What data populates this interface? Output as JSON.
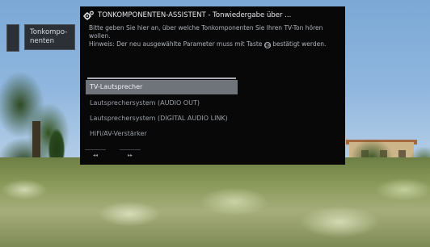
{
  "side_menu": {
    "item_label": "Tonkompo-\nnenten"
  },
  "dialog": {
    "title": "TONKOMPONENTEN-ASSISTENT - Tonwiedergabe über ...",
    "icon": "gears-icon",
    "instruction": "Bitte geben Sie hier an, über welche Tonkomponenten Sie Ihren TV-Ton hören wollen.",
    "hint_prefix": "Hinweis: Der neu ausgewählte Parameter muss mit Taste",
    "hint_symbol": "OK",
    "hint_suffix": "bestätigt werden.",
    "options": [
      {
        "label": "TV-Lautsprecher",
        "selected": true
      },
      {
        "label": "Lautsprechersystem (AUDIO OUT)",
        "selected": false
      },
      {
        "label": "Lautsprechersystem (DIGITAL AUDIO LINK)",
        "selected": false
      },
      {
        "label": "HiFi/AV-Verstärker",
        "selected": false
      }
    ],
    "nav": {
      "prev_label": "◂◂",
      "next_label": "▸▸"
    }
  },
  "colors": {
    "dialog_bg": "#080808",
    "selected_bg": "#6f747b",
    "text": "#c8ccd2"
  }
}
